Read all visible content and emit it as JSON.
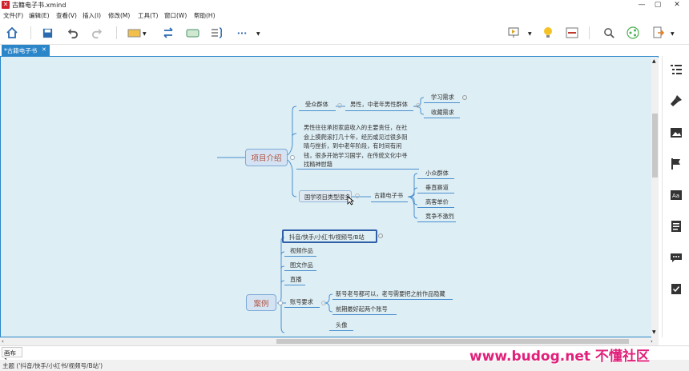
{
  "window": {
    "title": "古籍电子书.xmind",
    "controls": [
      "—",
      "▢",
      "✕"
    ]
  },
  "menu": [
    "文件(F)",
    "编辑(E)",
    "查看(V)",
    "插入(I)",
    "修改(M)",
    "工具(T)",
    "窗口(W)",
    "帮助(H)"
  ],
  "tab": {
    "label": "*古籍电子书",
    "close": "✕"
  },
  "mindmap": {
    "main_topics": {
      "intro": "项目介绍",
      "cases": "案例"
    },
    "intro_branch": {
      "audience_label": "受众群体",
      "audience_value": "男性，中老年男性群体",
      "needs": [
        "学习需求",
        "收藏需求"
      ],
      "paragraph": [
        "男性往往承担家庭收入的主要责任，在社",
        "会上摸爬滚打几十年，经历或见过很多阴",
        "晴与挫折，到中老年阶段，有时间有闲",
        "钱，很多开始学习国学，在传统文化中寻",
        "找精神慰藉"
      ],
      "project_type": "国学项目类型很多",
      "ebook": "古籍电子书",
      "ebook_traits": [
        "小众群体",
        "垂直赛道",
        "高客单价",
        "竞争不激烈"
      ]
    },
    "cases_branch": {
      "platforms": "抖音/快手/小红书/视频号/B站",
      "items": [
        "视频作品",
        "图文作品",
        "直播",
        "账号要求"
      ],
      "account_reqs": [
        "新号老号都可以，老号需要把之前作品隐藏",
        "前期最好起两个账号"
      ],
      "more": [
        "头像"
      ]
    }
  },
  "sheet": {
    "tab": "画布 1"
  },
  "status": {
    "text": "主题 ('抖音/快手/小红书/视频号/B站')"
  },
  "watermark": {
    "text": "www.budog.net 不懂社区"
  },
  "colors": {
    "canvas_bg": "#ddeef4",
    "accent": "#2b86c9",
    "topic_text": "#b0503c",
    "watermark": "#e0207a"
  }
}
